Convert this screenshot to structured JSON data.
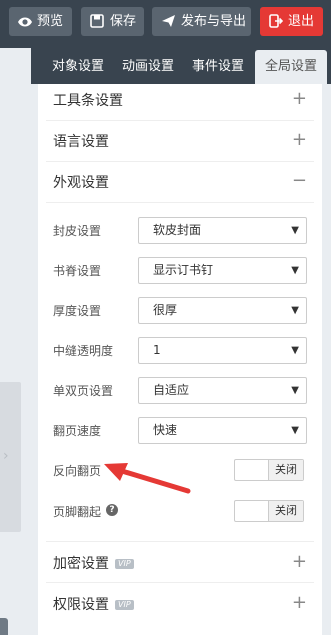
{
  "toolbar": {
    "preview": "预览",
    "save": "保存",
    "publish": "发布与导出",
    "exit": "退出",
    "exit_color": "#e53935"
  },
  "tabs": [
    {
      "label": "对象设置"
    },
    {
      "label": "动画设置"
    },
    {
      "label": "事件设置"
    },
    {
      "label": "全局设置",
      "active": true
    }
  ],
  "panel": {
    "toolbar_settings": "工具条设置",
    "language_settings": "语言设置",
    "appearance_settings": "外观设置",
    "encryption_settings": "加密设置",
    "permission_settings": "权限设置",
    "vip_badge": "VIP",
    "plus": "+",
    "minus": "−",
    "fields": {
      "cover": {
        "label": "封皮设置",
        "value": "软皮封面"
      },
      "spine": {
        "label": "书脊设置",
        "value": "显示订书钉"
      },
      "thickness": {
        "label": "厚度设置",
        "value": "很厚"
      },
      "seam": {
        "label": "中缝透明度",
        "value": "1"
      },
      "pages": {
        "label": "单双页设置",
        "value": "自适应"
      },
      "speed": {
        "label": "翻页速度",
        "value": "快速"
      },
      "reverse": {
        "label": "反向翻页",
        "value": "关闭"
      },
      "footer_curl": {
        "label": "页脚翻起",
        "value": "关闭"
      }
    },
    "caret": "▼",
    "help": "?"
  },
  "annotation_color": "#e53935"
}
